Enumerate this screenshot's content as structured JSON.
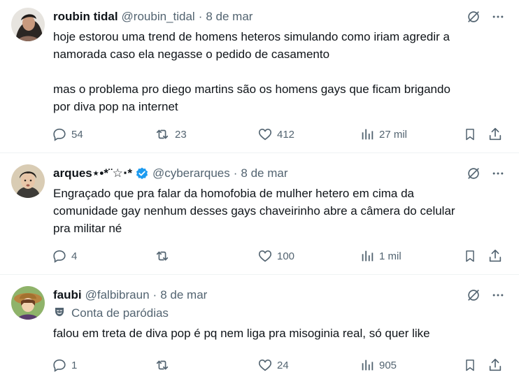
{
  "tweets": [
    {
      "name": "roubin tidal",
      "handle": "@roubin_tidal",
      "sep": "·",
      "date": "8 de mar",
      "text": [
        "hoje estorou uma trend de homens heteros simulando como iriam agredir a",
        "namorada caso ela negasse o pedido de casamento",
        "",
        "mas o problema pro diego martins são os homens gays que ficam brigando",
        "por diva pop na internet"
      ],
      "replies": "54",
      "retweets": "23",
      "likes": "412",
      "views": "27 mil"
    },
    {
      "name": "arques⋆•*¨☆⋅*",
      "handle": "@cyberarques",
      "sep": "·",
      "date": "8 de mar",
      "verified": true,
      "text": [
        "Engraçado que pra falar da homofobia de mulher hetero em cima da",
        "comunidade gay nenhum desses gays chaveirinho abre a câmera do celular",
        "pra militar né"
      ],
      "replies": "4",
      "retweets": "",
      "likes": "100",
      "views": "1 mil"
    },
    {
      "name": "faubi",
      "handle": "@falbibraun",
      "sep": "·",
      "date": "8 de mar",
      "parody_label": "Conta de paródias",
      "text": [
        "falou em treta de diva pop é pq nem liga pra misoginia real, só quer like"
      ],
      "replies": "1",
      "retweets": "",
      "likes": "24",
      "views": "905"
    }
  ],
  "icons": {
    "grok": "grok-icon",
    "more": "more-icon",
    "reply": "reply-icon",
    "retweet": "retweet-icon",
    "like": "like-icon",
    "views": "views-icon",
    "bookmark": "bookmark-icon",
    "share": "share-icon",
    "verified": "verified-badge-icon",
    "parody": "parody-mask-icon"
  },
  "colors": {
    "text": "#0f1419",
    "muted": "#536471",
    "verified": "#1d9bf0",
    "divider": "#eff3f4"
  }
}
